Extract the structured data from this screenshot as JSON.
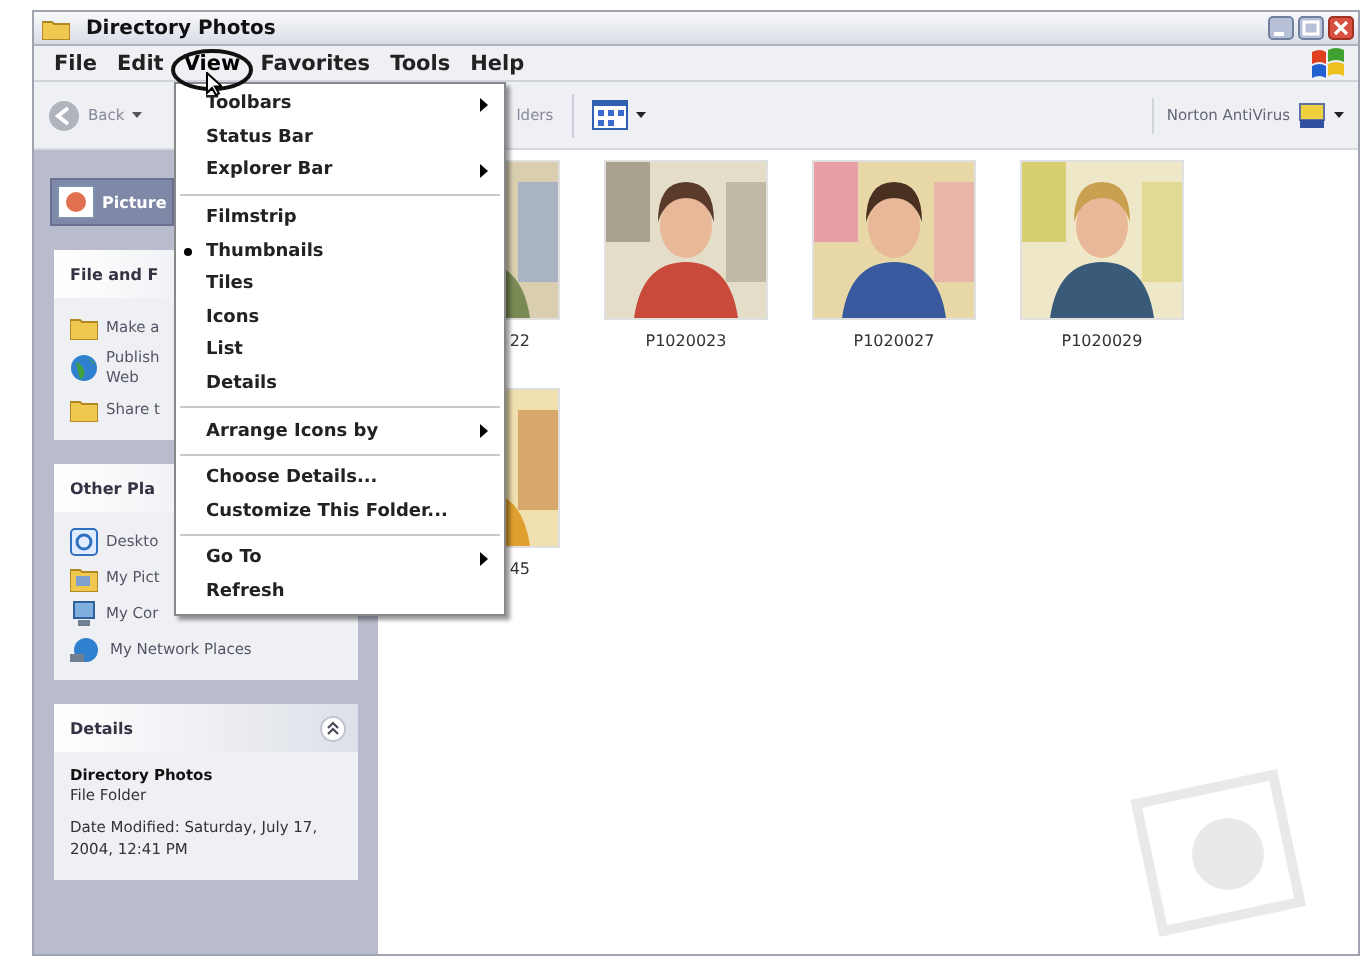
{
  "window": {
    "title": "Directory Photos"
  },
  "menu_bar": [
    {
      "label": "File",
      "selected": false
    },
    {
      "label": "Edit",
      "selected": false
    },
    {
      "label": "View",
      "selected": true
    },
    {
      "label": "Favorites",
      "selected": false
    },
    {
      "label": "Tools",
      "selected": false
    },
    {
      "label": "Help",
      "selected": false
    }
  ],
  "toolbar": {
    "back": "Back",
    "folders": "lders",
    "norton": "Norton AntiVirus"
  },
  "view_menu": [
    [
      {
        "label": "Toolbars",
        "submenu": true,
        "checked": false
      },
      {
        "label": "Status Bar",
        "submenu": false,
        "checked": false
      },
      {
        "label": "Explorer Bar",
        "submenu": true,
        "checked": false
      }
    ],
    [
      {
        "label": "Filmstrip",
        "submenu": false,
        "checked": false
      },
      {
        "label": "Thumbnails",
        "submenu": false,
        "checked": true
      },
      {
        "label": "Tiles",
        "submenu": false,
        "checked": false
      },
      {
        "label": "Icons",
        "submenu": false,
        "checked": false
      },
      {
        "label": "List",
        "submenu": false,
        "checked": false
      },
      {
        "label": "Details",
        "submenu": false,
        "checked": false
      }
    ],
    [
      {
        "label": "Arrange Icons by",
        "submenu": true,
        "checked": false
      }
    ],
    [
      {
        "label": "Choose Details...",
        "submenu": false,
        "checked": false
      },
      {
        "label": "Customize This Folder...",
        "submenu": false,
        "checked": false
      }
    ],
    [
      {
        "label": "Go To",
        "submenu": true,
        "checked": false
      },
      {
        "label": "Refresh",
        "submenu": false,
        "checked": false
      }
    ]
  ],
  "sidebar": {
    "header": "Picture",
    "panels": [
      {
        "title": "File and F",
        "items": [
          {
            "label": "Make a",
            "kind": "folder"
          },
          {
            "label": "Publish\nWeb",
            "kind": "globe"
          },
          {
            "label": "Share t",
            "kind": "folder"
          }
        ]
      },
      {
        "title": "Other Pla",
        "items": [
          {
            "label": "Deskto",
            "kind": "desktop"
          },
          {
            "label": "My Pict",
            "kind": "pictures"
          },
          {
            "label": "My Cor",
            "kind": "computer"
          },
          {
            "label": "My Network Places",
            "kind": "network"
          }
        ]
      }
    ],
    "details": {
      "title": "Details",
      "name": "Directory Photos",
      "type": "File Folder",
      "modified": "Date Modified: Saturday, July 17, 2004, 12:41 PM"
    }
  },
  "thumbnails": [
    [
      {
        "label": "22",
        "kind": "partial"
      },
      {
        "label": "P1020023",
        "kind": "full"
      },
      {
        "label": "P1020027",
        "kind": "full"
      },
      {
        "label": "P1020029",
        "kind": "full"
      }
    ],
    [
      {
        "label": "45",
        "kind": "partial"
      }
    ]
  ]
}
